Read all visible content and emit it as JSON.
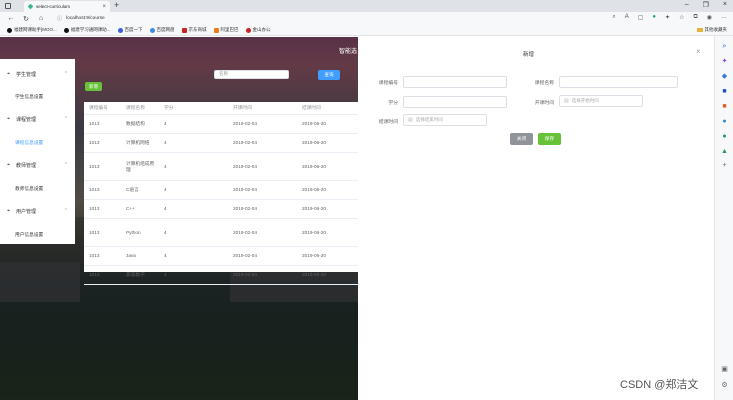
{
  "browser": {
    "tab_title": "select-curriculum",
    "url": "localhost:9/course",
    "bookmarks": [
      {
        "label": "福建网课助手[MOO...",
        "color": "#111111"
      },
      {
        "label": "福建学习通网课助...",
        "color": "#111111"
      },
      {
        "label": "百度一下",
        "color": "#3b5fe0"
      },
      {
        "label": "百度网盘",
        "color": "#3b8ee0"
      },
      {
        "label": "京东商城",
        "color": "#d02020"
      },
      {
        "label": "阿里巴巴",
        "color": "#f07a1a"
      },
      {
        "label": "金山办公",
        "color": "#d02020"
      }
    ],
    "bookmarks_folder": "其他收藏夹"
  },
  "header": {
    "system_title": "智能选"
  },
  "sidebar": {
    "groups": [
      {
        "label": "学生管理",
        "items": [
          "学生信息设置"
        ]
      },
      {
        "label": "课程管理",
        "items": [
          "课程信息设置"
        ]
      },
      {
        "label": "教师管理",
        "items": [
          "教师信息设置"
        ]
      },
      {
        "label": "用户管理",
        "items": [
          "用户信息设置"
        ]
      }
    ]
  },
  "toolbar": {
    "add_label": "新增",
    "search_placeholder": "名称",
    "search_label": "查询"
  },
  "table": {
    "headers": [
      "课程编号",
      "课程名称",
      "学分",
      "开课时间",
      "结课时间"
    ],
    "rows": [
      [
        "1013",
        "数据结构",
        "4",
        "2019-02-04",
        "2019-06-20"
      ],
      [
        "1013",
        "计算机网络",
        "4",
        "2019-02-04",
        "2019-06-20"
      ],
      [
        "1013",
        "计算机组成原理",
        "4",
        "2019-02-04",
        "2019-06-20"
      ],
      [
        "1013",
        "C语言",
        "4",
        "2019-02-04",
        "2019-06-20"
      ],
      [
        "1013",
        "C++",
        "4",
        "2019-02-04",
        "2019-06-20"
      ],
      [
        "1013",
        "Python",
        "4",
        "2019-02-04",
        "2019-06-20"
      ],
      [
        "1013",
        "Java",
        "4",
        "2019-02-04",
        "2019-06-20"
      ],
      [
        "1013",
        "高等数学",
        "4",
        "2019-02-04",
        "2019-06-20"
      ]
    ]
  },
  "dialog": {
    "title": "新增",
    "fields": {
      "course_no_label": "课程编号",
      "course_name_label": "课程名称",
      "credit_label": "学分",
      "start_label": "开课时间",
      "start_placeholder": "选择开始时间",
      "end_label": "结课时间",
      "end_placeholder": "选择结束时间"
    },
    "close_label": "关闭",
    "save_label": "保存"
  },
  "watermark": "CSDN @郑洁文"
}
